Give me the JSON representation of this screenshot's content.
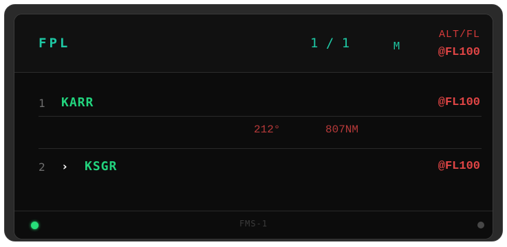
{
  "header": {
    "title": "FPL",
    "page_indicator": "1 / 1",
    "mode": "M",
    "alt_label": "ALT/FL",
    "alt_value": "@FL100"
  },
  "waypoints": [
    {
      "index": "1",
      "ident": "KARR",
      "alt": "@FL100",
      "selected": false
    },
    {
      "index": "2",
      "cursor": "›",
      "ident": "KSGR",
      "alt": "@FL100",
      "selected": true
    }
  ],
  "leg": {
    "course": "212°",
    "distance": "807NM"
  },
  "footer": {
    "unit_label": "FMS-1"
  },
  "colors": {
    "title": "#1ec8a4",
    "waypoint": "#22d47e",
    "altitude": "#e04545",
    "leg": "#b83a3a",
    "status_led_active": "#27e07a",
    "status_led_inactive": "#474747"
  }
}
